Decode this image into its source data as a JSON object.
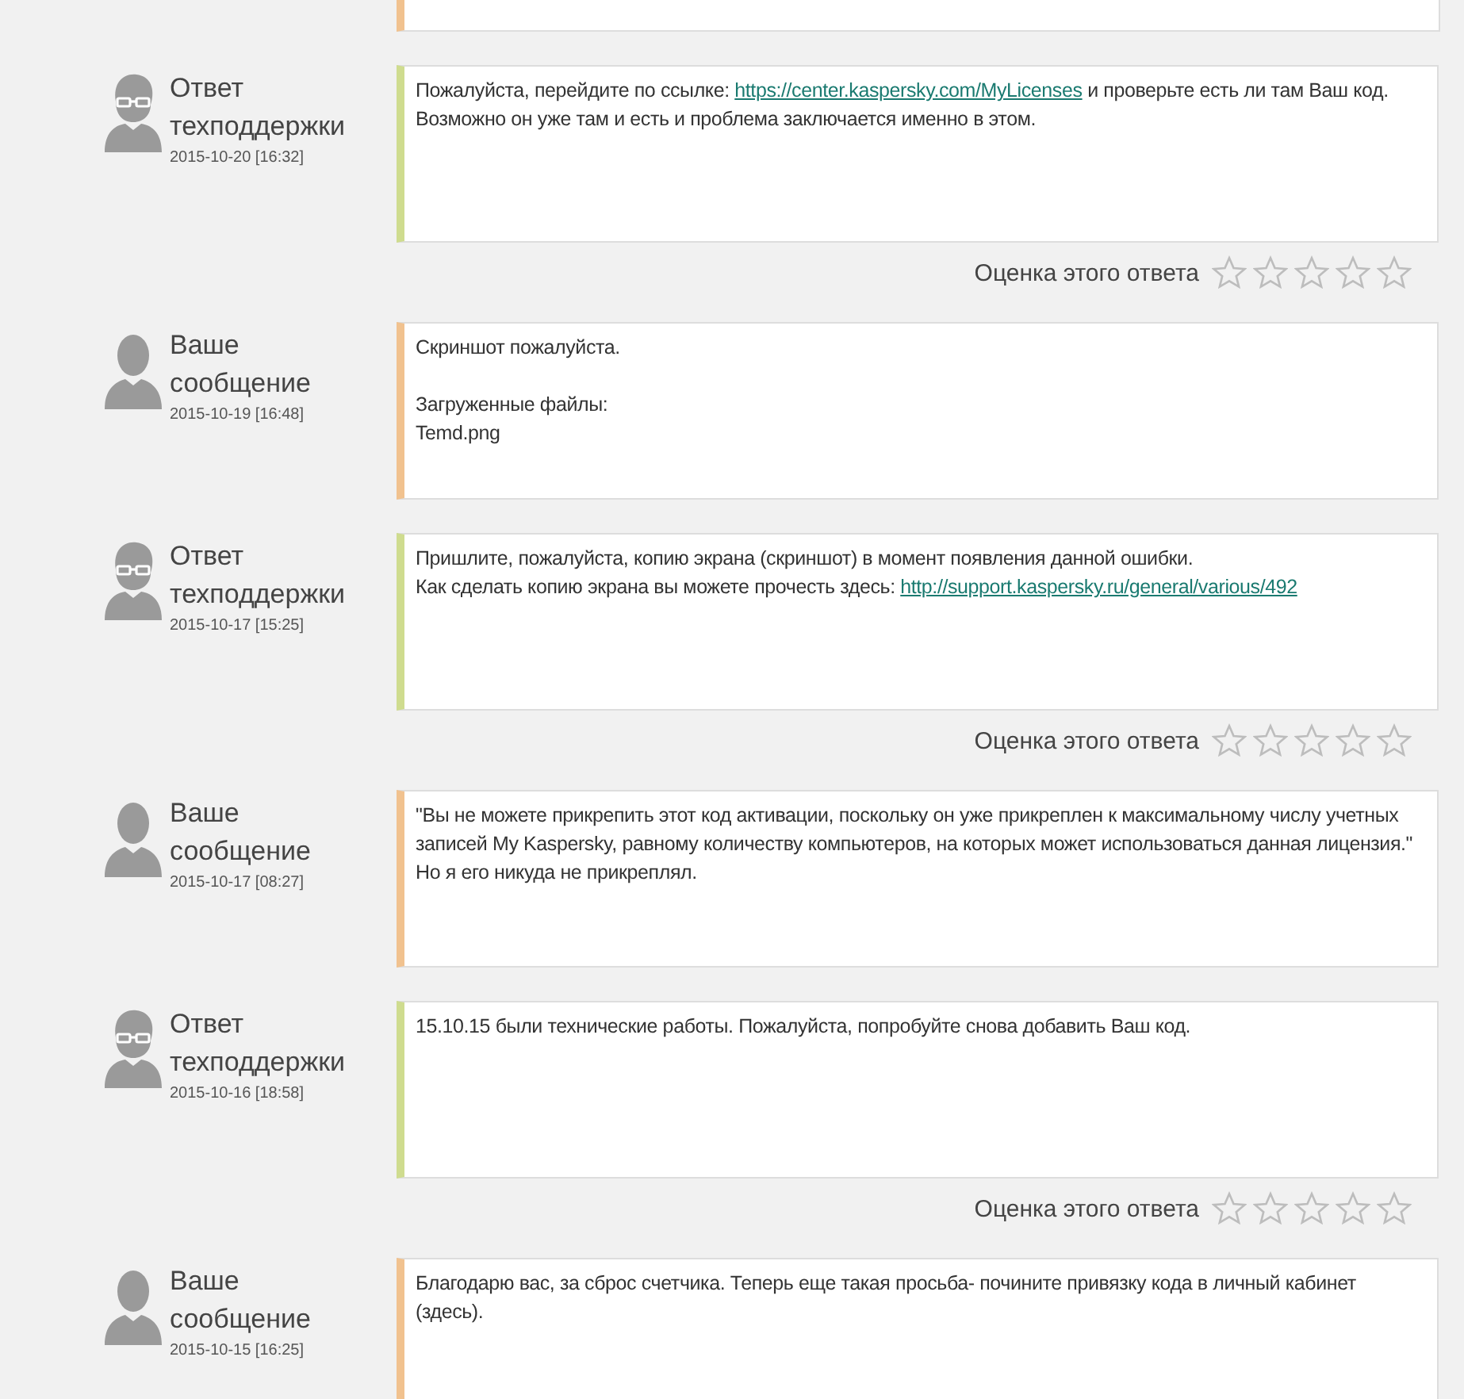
{
  "top_fragment": {
    "kind": "user"
  },
  "messages": [
    {
      "kind": "support",
      "author": "Ответ техподдержки",
      "date": "2015-10-20 [16:32]",
      "paragraphs": [
        [
          [
            {
              "kind": "text",
              "text": "Пожалуйста, перейдите по ссылке: "
            },
            {
              "kind": "link",
              "text": "https://center.kaspersky.com/MyLicenses"
            },
            {
              "kind": "text",
              "text": " и проверьте есть ли там Ваш код. Возможно он уже там и есть и проблема заключается именно в этом."
            }
          ]
        ]
      ],
      "rating": {
        "label": "Оценка этого ответа",
        "stars": 0
      }
    },
    {
      "kind": "user",
      "author": "Ваше сообщение",
      "date": "2015-10-19 [16:48]",
      "paragraphs": [
        [
          [
            {
              "kind": "text",
              "text": "Скриншот пожалуйста."
            }
          ]
        ],
        [
          [
            {
              "kind": "text",
              "text": "Загруженные файлы:"
            }
          ],
          [
            {
              "kind": "text",
              "text": "Temd.png"
            }
          ]
        ]
      ]
    },
    {
      "kind": "support",
      "author": "Ответ техподдержки",
      "date": "2015-10-17 [15:25]",
      "paragraphs": [
        [
          [
            {
              "kind": "text",
              "text": "Пришлите, пожалуйста, копию экрана (скриншот) в момент появления данной ошибки."
            }
          ],
          [
            {
              "kind": "text",
              "text": "Как сделать копию экрана вы можете прочесть здесь: "
            },
            {
              "kind": "link",
              "text": "http://support.kaspersky.ru/general/various/492"
            }
          ]
        ]
      ],
      "rating": {
        "label": "Оценка этого ответа",
        "stars": 0
      }
    },
    {
      "kind": "user",
      "author": "Ваше сообщение",
      "date": "2015-10-17 [08:27]",
      "paragraphs": [
        [
          [
            {
              "kind": "text",
              "text": "\"Вы не можете прикрепить этот код активации, поскольку он уже прикреплен к максимальному числу учетных записей My Kaspersky, равному количеству компьютеров, на которых может использоваться данная лицензия.\""
            }
          ],
          [
            {
              "kind": "text",
              "text": "Но я его никуда не прикреплял."
            }
          ]
        ]
      ]
    },
    {
      "kind": "support",
      "author": "Ответ техподдержки",
      "date": "2015-10-16 [18:58]",
      "paragraphs": [
        [
          [
            {
              "kind": "text",
              "text": "15.10.15 были технические работы. Пожалуйста, попробуйте снова добавить Ваш код."
            }
          ]
        ]
      ],
      "rating": {
        "label": "Оценка этого ответа",
        "stars": 0
      }
    },
    {
      "kind": "user",
      "author": "Ваше сообщение",
      "date": "2015-10-15 [16:25]",
      "paragraphs": [
        [
          [
            {
              "kind": "text",
              "text": "Благодарю вас, за сброс счетчика. Теперь еще такая просьба- почините привязку кода в личный кабинет (здесь)."
            }
          ]
        ]
      ]
    }
  ]
}
